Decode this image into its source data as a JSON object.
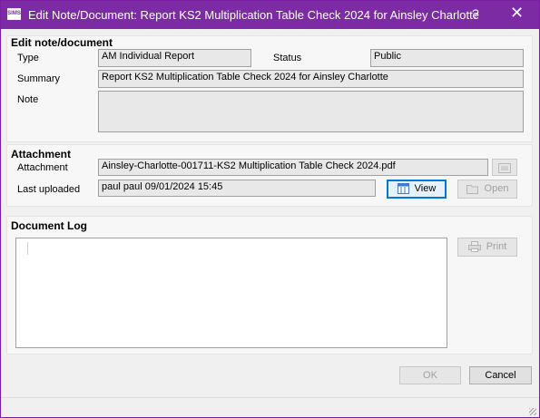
{
  "window": {
    "app_icon_text": "SIMS",
    "title": "Edit Note/Document: Report KS2 Multiplication Table Check 2024 for Ainsley Charlotte",
    "help_glyph": "?",
    "close_glyph": "✕"
  },
  "edit_section": {
    "heading": "Edit note/document",
    "type_label": "Type",
    "type_value": "AM Individual Report",
    "status_label": "Status",
    "status_value": "Public",
    "summary_label": "Summary",
    "summary_value": "Report KS2 Multiplication Table Check 2024 for Ainsley Charlotte",
    "note_label": "Note",
    "note_value": ""
  },
  "attachment_section": {
    "heading": "Attachment",
    "attachment_label": "Attachment",
    "attachment_value": "Ainsley-Charlotte-001711-KS2 Multiplication Table Check 2024.pdf",
    "last_uploaded_label": "Last uploaded",
    "last_uploaded_value": "paul paul 09/01/2024 15:45",
    "view_label": "View",
    "open_label": "Open",
    "view_icon": "document-view-icon",
    "open_icon": "folder-open-icon",
    "browse_icon": "browse-icon"
  },
  "log_section": {
    "heading": "Document Log",
    "print_label": "Print",
    "print_icon": "printer-icon"
  },
  "footer": {
    "ok_label": "OK",
    "cancel_label": "Cancel"
  },
  "colors": {
    "titlebar": "#7d2aa5",
    "focus_border": "#0078d7"
  }
}
